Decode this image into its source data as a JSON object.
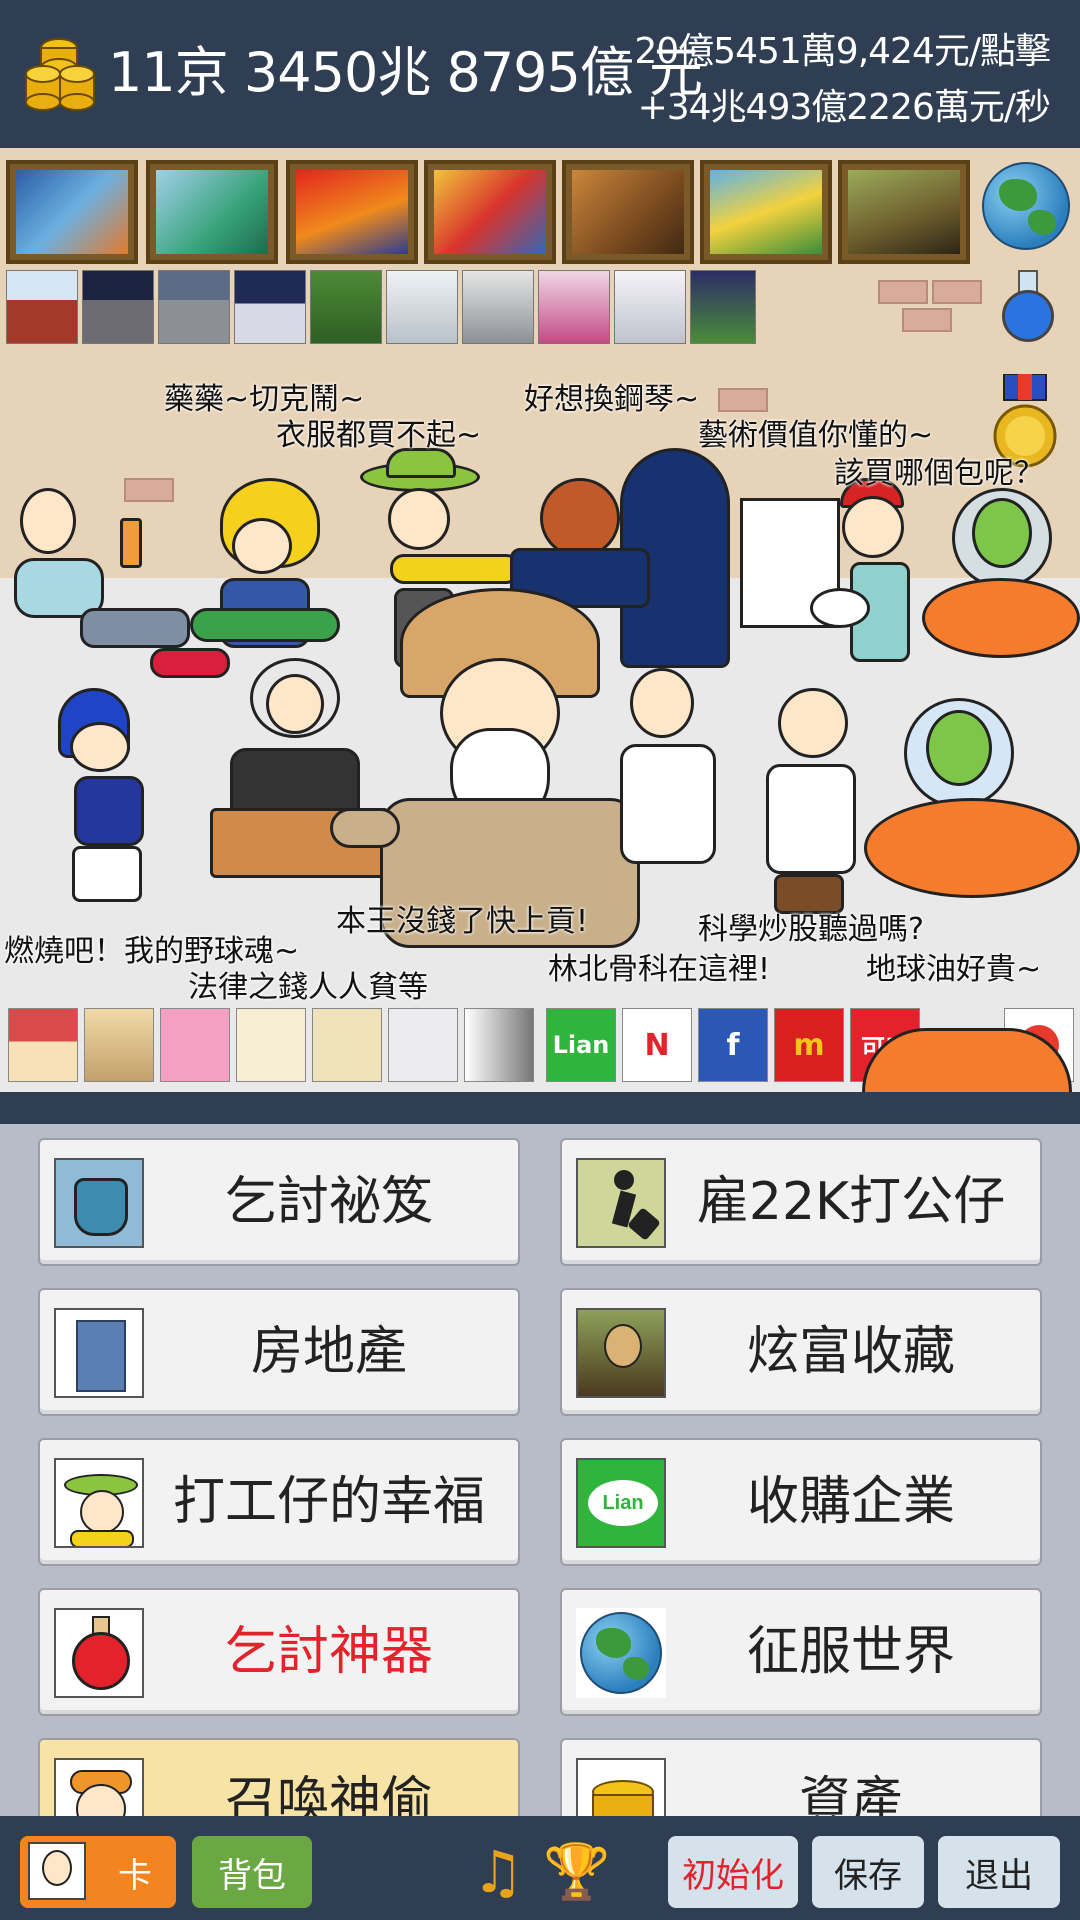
{
  "hud": {
    "money": "11京 3450兆 8795億 元",
    "rate_per_click": "20億5451萬9,424元/點擊",
    "rate_per_second": "+34兆493億2226萬元/秒"
  },
  "scene": {
    "speech": [
      "藥藥~切克鬧~",
      "衣服都買不起~",
      "好想換鋼琴~",
      "藝術價值你懂的~",
      "該買哪個包呢？",
      "燃燒吧！我的野球魂~",
      "法律之錢人人貧等",
      "本王沒錢了快上貢!",
      "林北骨科在這裡!",
      "科學炒股聽過嗎?",
      "地球油好貴~"
    ],
    "strip_brands": [
      "Lian",
      "N",
      "f",
      "m",
      "可口"
    ]
  },
  "menu": {
    "buttons": [
      {
        "label": "乞討祕笈",
        "icon": "bag-icon"
      },
      {
        "label": "雇22K打公仔",
        "icon": "worker-icon"
      },
      {
        "label": "房地產",
        "icon": "building-icon"
      },
      {
        "label": "炫富收藏",
        "icon": "mona-lisa-icon"
      },
      {
        "label": "打工仔的幸福",
        "icon": "green-hat-guy-icon"
      },
      {
        "label": "收購企業",
        "icon": "lian-logo-icon"
      },
      {
        "label": "乞討神器",
        "icon": "red-potion-icon"
      },
      {
        "label": "征服世界",
        "icon": "globe-icon"
      },
      {
        "label": "召喚神偷",
        "icon": "thief-icon"
      },
      {
        "label": "資產",
        "icon": "coin-stack-icon"
      }
    ]
  },
  "bottom": {
    "card_label": "卡",
    "bag_label": "背包",
    "reset_label": "初始化",
    "save_label": "保存",
    "exit_label": "退出",
    "music_glyph": "♫",
    "trophy_glyph": "🏆"
  },
  "colors": {
    "header_bg": "#2f3e52",
    "menu_bg": "#b8bcc6",
    "accent_orange": "#f4841f",
    "accent_green": "#6ba843",
    "alert_red": "#e3222b"
  }
}
